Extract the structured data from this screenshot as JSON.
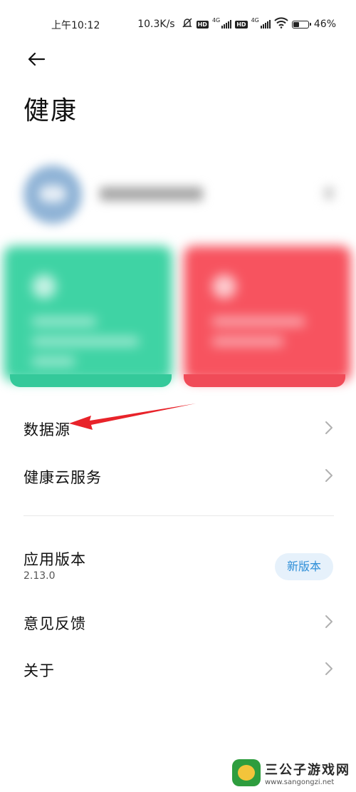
{
  "status_bar": {
    "time": "上午10:12",
    "net_speed": "10.3K/s",
    "hd_label": "HD",
    "lte_label": "4G",
    "battery_percent": 46,
    "battery_text": "46%"
  },
  "header": {
    "back_icon": "arrow-left-icon",
    "title": "健康"
  },
  "menu": {
    "data_source": "数据源",
    "health_cloud": "健康云服务",
    "app_version_label": "应用版本",
    "app_version_value": "2.13.0",
    "new_version_button": "新版本",
    "feedback": "意见反馈",
    "about": "关于"
  },
  "colors": {
    "accent_blue": "#2f8fd8",
    "card_green": "#3fd3a4",
    "card_red": "#f7535f",
    "arrow_red": "#e8232a"
  },
  "watermark": {
    "title": "三公子游戏网",
    "url": "www.sangongzi.net"
  }
}
